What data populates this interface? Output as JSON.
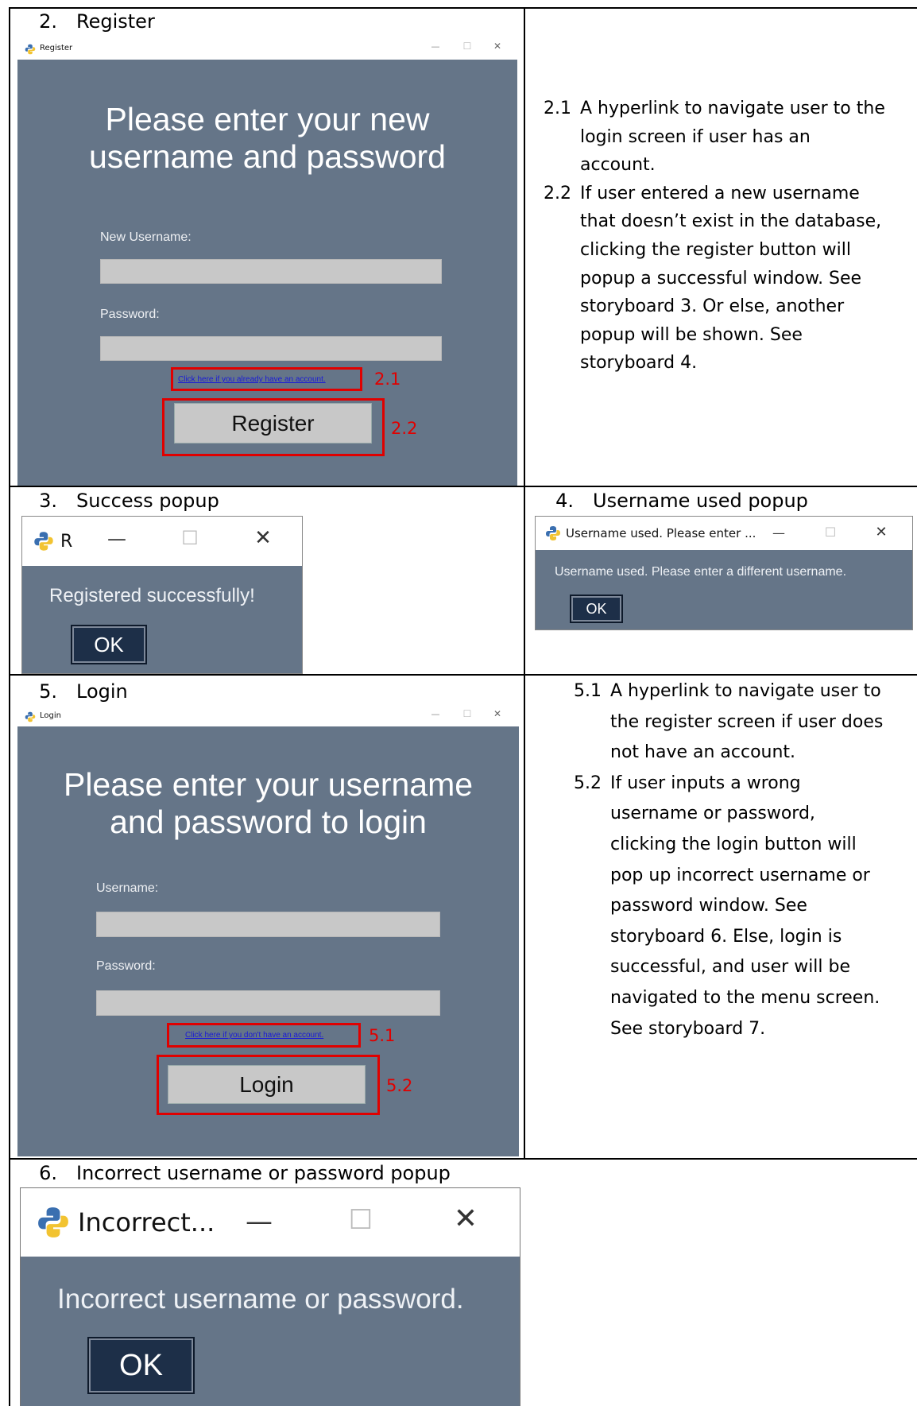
{
  "sections": {
    "s2": {
      "num": "2.",
      "title": "Register"
    },
    "s3": {
      "num": "3.",
      "title": "Success popup"
    },
    "s4": {
      "num": "4.",
      "title": "Username used popup"
    },
    "s5": {
      "num": "5.",
      "title": "Login"
    },
    "s6": {
      "num": "6.",
      "title": "Incorrect username or password popup"
    }
  },
  "register_window": {
    "title": "Register",
    "heading_line1": "Please enter your new",
    "heading_line2": "username and password",
    "username_label": "New Username:",
    "password_label": "Password:",
    "link_text": "Click here if you already have an account.",
    "button_label": "Register",
    "callout_link": "2.1",
    "callout_button": "2.2"
  },
  "register_notes": [
    {
      "num": "2.1",
      "lines": [
        "A hyperlink to navigate user to the",
        "login screen if user has an",
        "account."
      ]
    },
    {
      "num": "2.2",
      "lines": [
        "If user entered a new username",
        "that doesn’t exist in the database,",
        "clicking the register button will",
        "popup a successful window. See",
        "storyboard 3. Or else, another",
        "popup will be shown. See",
        "storyboard 4."
      ]
    }
  ],
  "success_popup": {
    "title": "R",
    "message": "Registered successfully!",
    "ok": "OK"
  },
  "used_popup": {
    "title": "Username used. Please enter ...",
    "message": "Username used. Please enter a different username.",
    "ok": "OK"
  },
  "login_window": {
    "title": "Login",
    "heading_line1": "Please enter your username",
    "heading_line2": "and password to login",
    "username_label": "Username:",
    "password_label": "Password:",
    "link_text": "Click here if you don't have an account.",
    "button_label": "Login",
    "callout_link": "5.1",
    "callout_button": "5.2"
  },
  "login_notes": [
    {
      "num": "5.1",
      "lines": [
        "A hyperlink to navigate user to",
        "the register screen if user does",
        "not have an account."
      ]
    },
    {
      "num": "5.2",
      "lines": [
        "If user inputs a wrong",
        "username or password,",
        "clicking the login button will",
        "pop up incorrect username or",
        "password window. See",
        "storyboard 6. Else, login is",
        "successful, and user will be",
        "navigated to the menu screen.",
        "See storyboard 7."
      ]
    }
  ],
  "incorrect_popup": {
    "title": "Incorrect...",
    "message": "Incorrect username or password.",
    "ok": "OK"
  },
  "window_controls": {
    "minimize": "—",
    "maximize": "☐",
    "close": "✕"
  },
  "colors": {
    "window_bg": "#657588",
    "callout": "#e00000",
    "ok_button": "#1d2f48"
  }
}
